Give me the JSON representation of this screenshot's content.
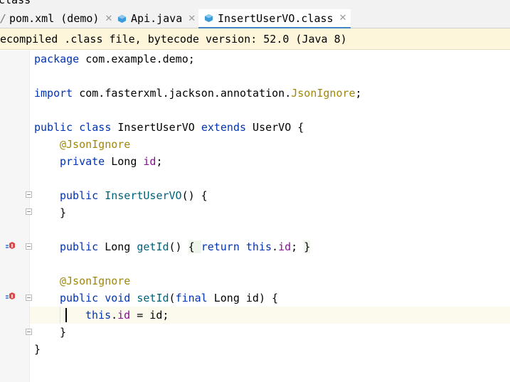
{
  "breadcrumb": {
    "text": "class"
  },
  "tabs": [
    {
      "label": "pom.xml (demo)",
      "icon": "maven-file-icon",
      "active": false
    },
    {
      "label": "Api.java",
      "icon": "java-interface-icon",
      "active": false
    },
    {
      "label": "InsertUserVO.class",
      "icon": "java-class-file-icon",
      "active": true
    }
  ],
  "banner": {
    "text": "ecompiled .class file, bytecode version: 52.0 (Java 8)"
  },
  "code": {
    "l1_kw": "package",
    "l1_rest": " com.example.demo;",
    "l3_kw": "import",
    "l3_pkg": " com.fasterxml.jackson.annotation.",
    "l3_ann": "JsonIgnore",
    "l3_end": ";",
    "l5_kw1": "public",
    "l5_kw2": "class",
    "l5_name": "InsertUserVO",
    "l5_kw3": "extends",
    "l5_rest": " UserVO {",
    "l6_ann": "@JsonIgnore",
    "l7_kw": "private",
    "l7_type": " Long ",
    "l7_field": "id",
    "l7_end": ";",
    "l9_kw": "public",
    "l9_name": "InsertUserVO",
    "l9_rest": "() {",
    "l10": "}",
    "l12_kw": "public",
    "l12_type": " Long ",
    "l12_name": "getId",
    "l12_paren": "() ",
    "l12_open": "{ ",
    "l12_ret": "return",
    "l12_this": "this",
    "l12_dot": ".",
    "l12_field": "id",
    "l12_semi": "; ",
    "l12_close": "}",
    "l14_ann": "@JsonIgnore",
    "l15_kw1": "public",
    "l15_kw2": "void",
    "l15_name": "setId",
    "l15_open": "(",
    "l15_kw3": "final",
    "l15_rest": " Long id) {",
    "l16_this": "this",
    "l16_dot": ".",
    "l16_field": "id",
    "l16_rest": " = id;",
    "l17": "}",
    "l18": "}"
  }
}
